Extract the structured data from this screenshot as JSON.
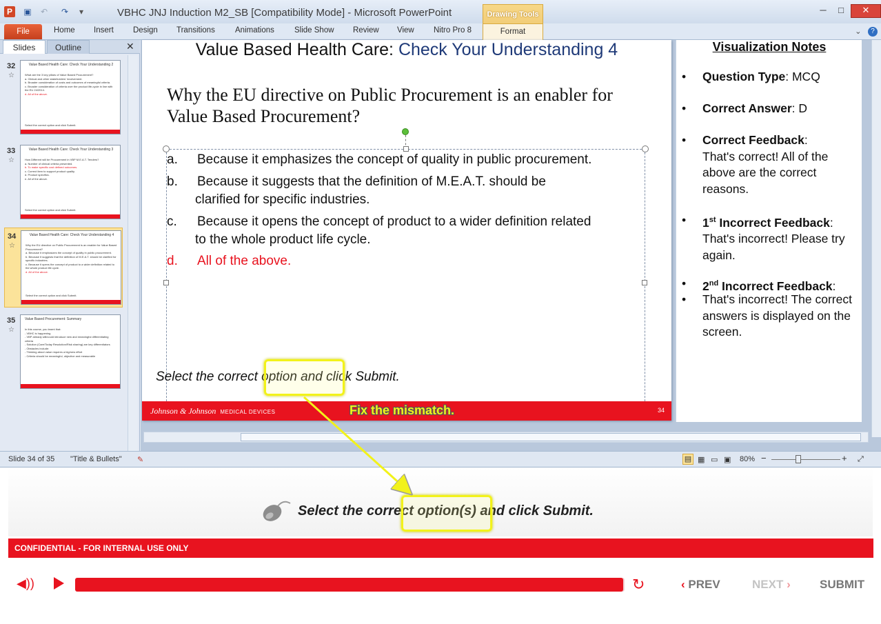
{
  "window": {
    "title": "VBHC JNJ Induction M2_SB [Compatibility Mode]  -  Microsoft PowerPoint",
    "contextual_group": "Drawing Tools",
    "minimize": "─",
    "maximize": "□",
    "close": "✕"
  },
  "ribbon": {
    "file": "File",
    "tabs": [
      "Home",
      "Insert",
      "Design",
      "Transitions",
      "Animations",
      "Slide Show",
      "Review",
      "View",
      "Nitro Pro 8"
    ],
    "contextual_tab": "Format"
  },
  "pane": {
    "tab_slides": "Slides",
    "tab_outline": "Outline",
    "close": "✕",
    "thumbnails": [
      {
        "num": "32",
        "title": "Value Based Health Care: Check Your Understanding 2",
        "lines": [
          "What are the 3 key pillars of Value Based Procurement?",
          "a. Clinical and other stakeholders' involvement.",
          "b. Broader consideration of costs and outcomes of meaningful criteria.",
          "c. Broader consideration of criteria over the product life-cycle in line with the EU 24/2014.",
          "d. All of the above."
        ],
        "footer": "Select the correct option and click Submit."
      },
      {
        "num": "33",
        "title": "Value Based Health Care: Check Your Understanding 3",
        "lines": [
          "How Different will be Procurement in VBP M.E.A.T. Tenders?",
          "a. Number of clinical criteria presented.",
          "b. To make specific cost defined outcomes.",
          "c. Correct item to support product quality.",
          "d. Product specifics.",
          "e. All of the above."
        ],
        "footer": "Select the correct option and click Submit."
      },
      {
        "num": "34",
        "title": "Value Based Health Care: Check Your Understanding 4",
        "lines": [
          "Why the EU directive on Public Procurement is an enabler for Value Based Procurement?",
          "a. Because it emphasizes the concept of quality in public procurement.",
          "b. Because it suggests that the definition of M.E.A.T. should be clarified for specific industries.",
          "c. Because it opens the concept of product to a wider definition related to the whole product life cycle.",
          "d. All of the above."
        ],
        "footer": "Select the correct option and click Submit."
      },
      {
        "num": "35",
        "title": "Value Based Procurement: Summary",
        "lines": [
          "In this course, you learnt that:",
          "- VBHC is happening",
          "- VBP already will/could introduce new and meaningful differentiating criteria",
          "- Solution (Care/Today Resolution/Risk sharing) are key differentiators",
          "- Obstacles include:",
          "  - Thinking about value requires a big/new effort",
          "  - Criteria should be meaningful, objective and measurable"
        ],
        "footer": ""
      }
    ]
  },
  "slide": {
    "title_prefix": "Value Based Health Care: ",
    "title_accent": "Check Your Understanding 4",
    "question": "Why the EU directive on Public Procurement is an enabler for Value Based Procurement?",
    "options": [
      {
        "letter": "a.",
        "text": "Because it emphasizes  the concept of quality  in public  procurement."
      },
      {
        "letter": "b.",
        "text": "Because it suggests that the definition of M.E.A.T.  should  be",
        "cont": "clarified for specific industries."
      },
      {
        "letter": "c.",
        "text": "Because it opens the concept of product to a wider definition related",
        "cont": "to the whole product life cycle."
      },
      {
        "letter": "d.",
        "text": "All  of the above."
      }
    ],
    "instruction": "Select the correct option and click Submit.",
    "footer_logo": "Johnson & Johnson",
    "footer_logo_sub": "MEDICAL DEVICES",
    "number": "34"
  },
  "notes": {
    "title": "Visualization Notes",
    "items": [
      {
        "label": "Question Type",
        "sep": ": ",
        "value": "MCQ"
      },
      {
        "label": "Correct Answer",
        "sep": ": ",
        "value": "D"
      },
      {
        "label": "Correct Feedback",
        "sep": ":",
        "value": "That's correct! All of the above are the correct reasons."
      },
      {
        "label_num": "1",
        "label_sup": "st",
        "label": " Incorrect Feedback",
        "sep": ":",
        "value": "That's incorrect! Please try again."
      },
      {
        "label_num": "2",
        "label_sup": "nd",
        "label": " Incorrect Feedback",
        "sep": ":",
        "value": "That's incorrect! The correct answers is displayed on the screen."
      }
    ]
  },
  "statusbar": {
    "slide_of": "Slide 34 of 35",
    "theme": "\"Title & Bullets\"",
    "zoom": "80%",
    "zoom_minus": "−",
    "zoom_plus": "+"
  },
  "player": {
    "prompt": "Select the correct option(s) and click Submit.",
    "confidential": "CONFIDENTIAL - FOR INTERNAL USE ONLY",
    "progress": 0.998,
    "prev_label": "PREV",
    "next_label": "NEXT",
    "submit_label": "SUBMIT",
    "prev_chevron": "‹",
    "next_chevron": "›"
  },
  "annotation": {
    "label": "Fix the mismatch.",
    "color": "#f2f21a"
  }
}
